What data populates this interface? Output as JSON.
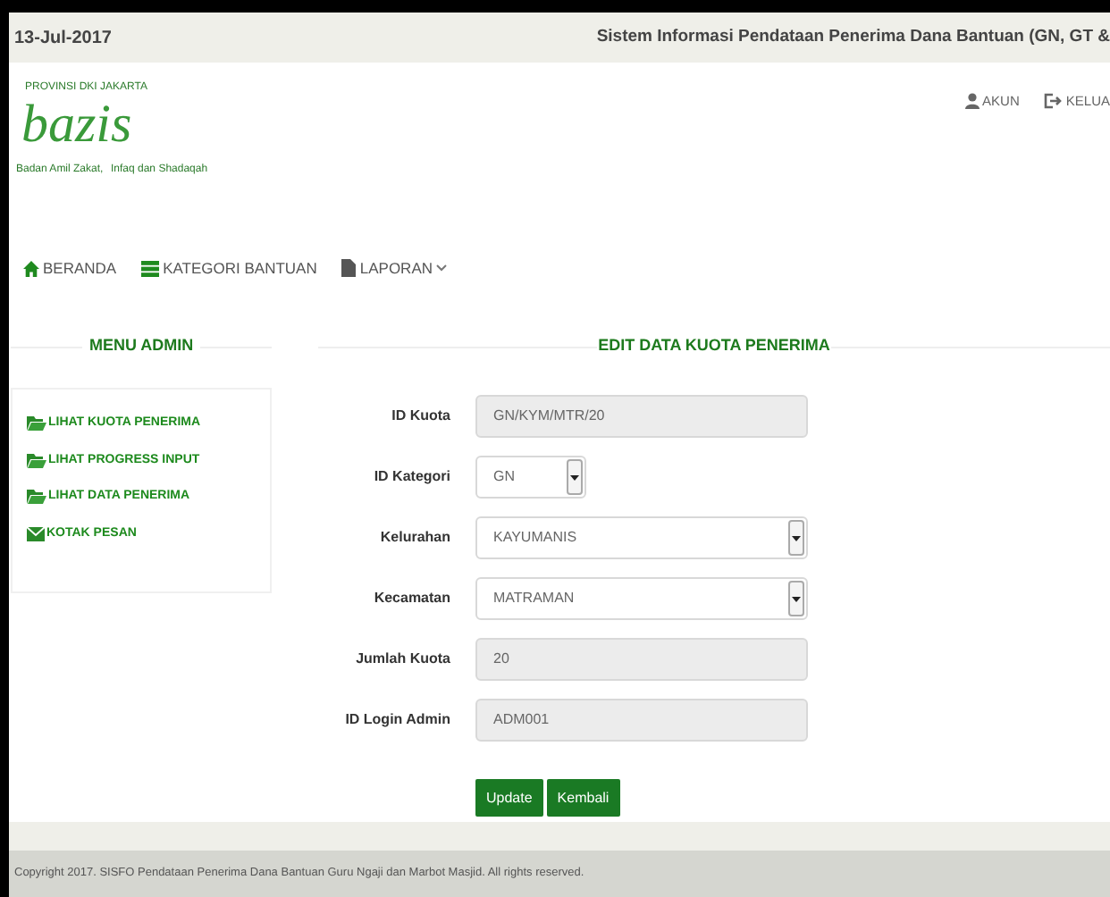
{
  "top_bar": {
    "date": "13-Jul-2017",
    "title": "Sistem Informasi Pendataan Penerima Dana Bantuan (GN, GT &"
  },
  "logo": {
    "top_text": "PROVINSI DKI JAKARTA",
    "word": "bazis",
    "left_text": "Badan Amil Zakat,",
    "right_text": "Infaq dan Shadaqah"
  },
  "user_links": [
    {
      "label": "AKUN",
      "kind": "user"
    },
    {
      "label": "KELUA",
      "kind": "logout"
    }
  ],
  "nav": [
    {
      "label": "BERANDA",
      "kind": "home",
      "dropdown": false
    },
    {
      "label": "KATEGORI BANTUAN",
      "kind": "list",
      "dropdown": false
    },
    {
      "label": "LAPORAN",
      "kind": "file",
      "dropdown": true
    }
  ],
  "sidebar": {
    "heading": "MENU ADMIN",
    "items": [
      {
        "label": "LIHAT KUOTA PENERIMA",
        "kind": "folder"
      },
      {
        "label": "LIHAT PROGRESS INPUT",
        "kind": "folder"
      },
      {
        "label": "LIHAT DATA PENERIMA",
        "kind": "folder"
      },
      {
        "label": "KOTAK PESAN",
        "kind": "mail"
      }
    ]
  },
  "form": {
    "heading": "EDIT DATA KUOTA PENERIMA",
    "fields": [
      {
        "label": "ID Kuota",
        "value": "GN/KYM/MTR/20",
        "kind": "text",
        "disabled": true
      },
      {
        "label": "ID Kategori",
        "value": "GN",
        "kind": "select-small",
        "disabled": false
      },
      {
        "label": "Kelurahan",
        "value": "KAYUMANIS",
        "kind": "select",
        "disabled": false
      },
      {
        "label": "Kecamatan",
        "value": "MATRAMAN",
        "kind": "select",
        "disabled": false
      },
      {
        "label": "Jumlah Kuota",
        "value": "20",
        "kind": "text",
        "disabled": true
      },
      {
        "label": "ID Login Admin",
        "value": "ADM001",
        "kind": "text",
        "disabled": true
      }
    ],
    "buttons": [
      "Update",
      "Kembali"
    ]
  },
  "footer": "Copyright 2017. SISFO Pendataan Penerima Dana Bantuan Guru Ngaji dan Marbot Masjid. All rights reserved."
}
